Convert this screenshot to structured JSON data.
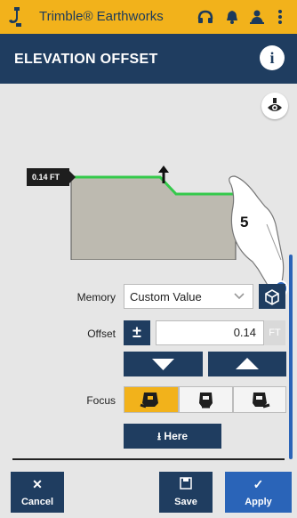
{
  "status_bar": {
    "app_name": "Trimble® Earthworks"
  },
  "header": {
    "title": "ELEVATION OFFSET",
    "info_glyph": "i"
  },
  "diagram": {
    "offset_tag": "0.14 FT",
    "callout_number": "5"
  },
  "memory": {
    "label": "Memory",
    "value": "Custom Value"
  },
  "offset": {
    "label": "Offset",
    "plus_minus": "±",
    "value": "0.14",
    "unit": "FT"
  },
  "focus": {
    "label": "Focus",
    "selected_index": 0
  },
  "here_button": {
    "label": "Here"
  },
  "bottom_bar": {
    "cancel": "Cancel",
    "save": "Save",
    "apply": "Apply"
  },
  "colors": {
    "status_bar": "#f2b21b",
    "header": "#1f3d60",
    "accent_green": "#34c94a",
    "focus_selected": "#f2b21b",
    "apply_button": "#2a64b8"
  },
  "icons": [
    "excavator-icon",
    "headset-icon",
    "bell-icon",
    "person-icon",
    "more-vertical-icon",
    "info-icon",
    "eye-view-icon",
    "chevron-down-icon",
    "box-icon",
    "arrow-down-icon",
    "arrow-up-icon",
    "bucket-focus-left-icon",
    "bucket-focus-center-icon",
    "bucket-focus-right-icon",
    "download-icon",
    "close-icon",
    "save-icon",
    "check-icon"
  ]
}
